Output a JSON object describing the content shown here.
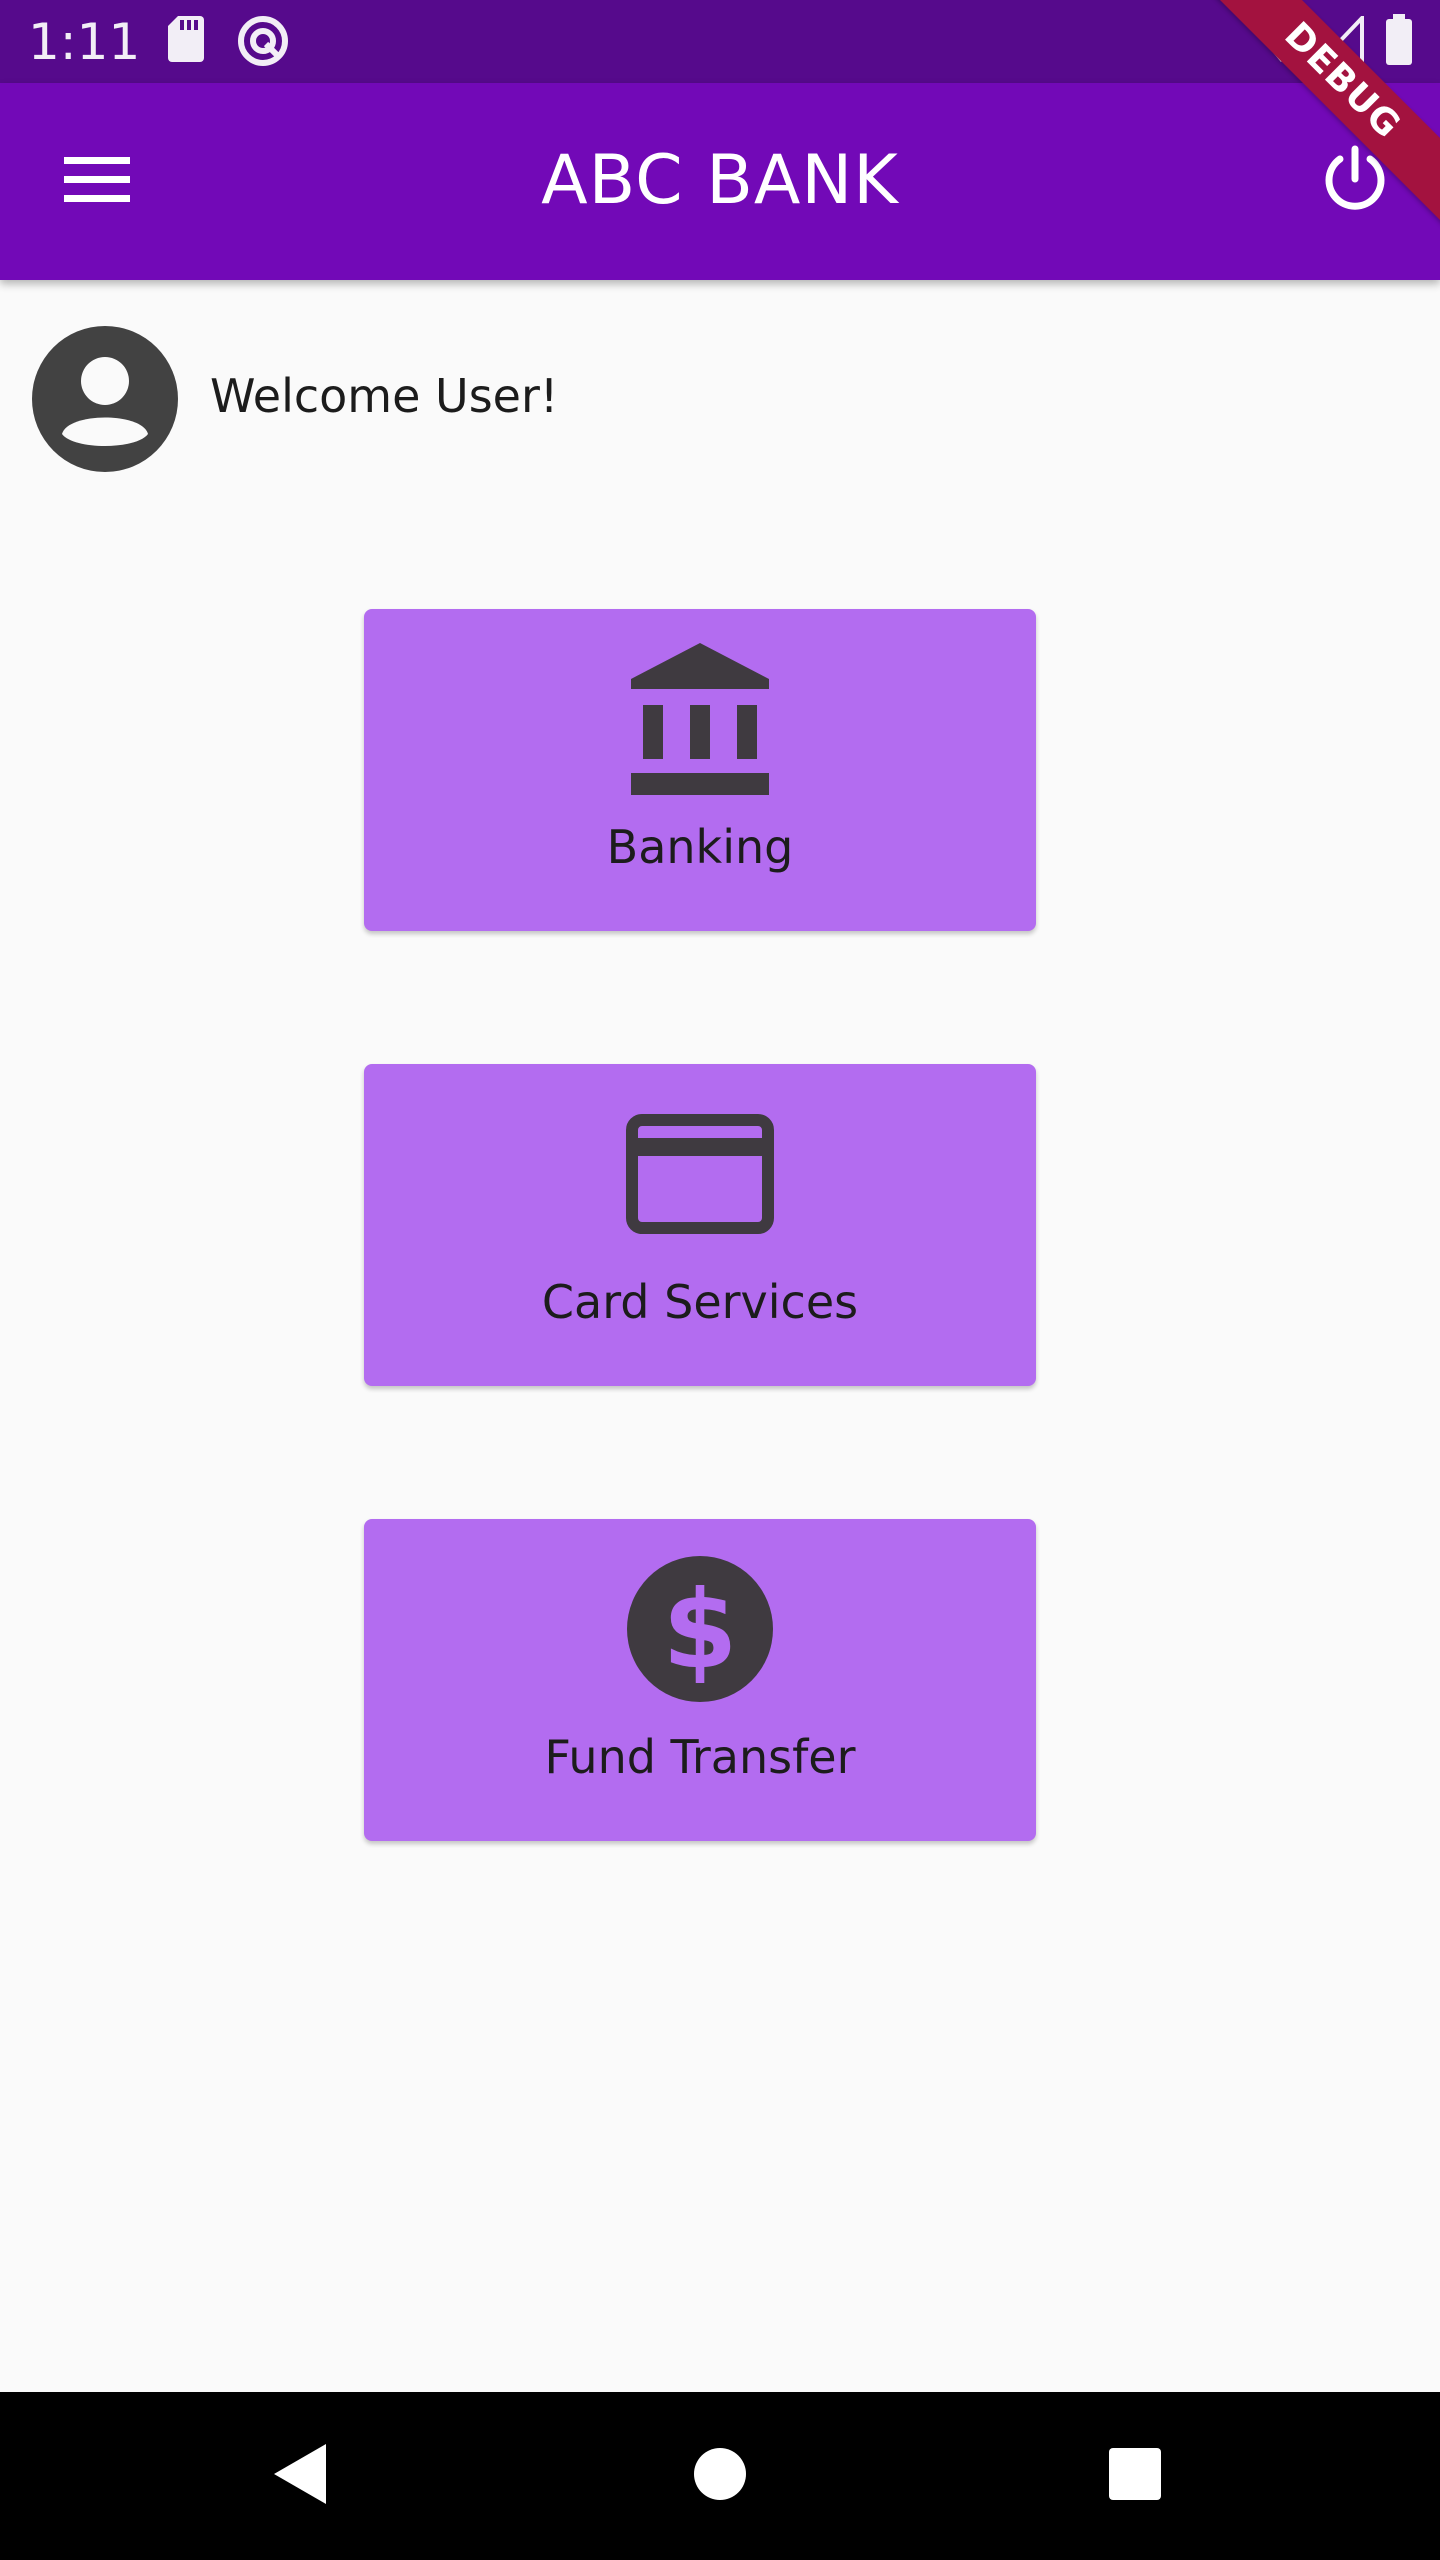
{
  "status_bar": {
    "time": "1:11",
    "icons": [
      "sd-card-icon",
      "sync-icon",
      "wifi-icon",
      "signal-icon",
      "battery-icon"
    ]
  },
  "app_bar": {
    "title": "ABC BANK",
    "menu_icon": "menu-icon",
    "power_icon": "power-icon",
    "debug_label": "DEBUG"
  },
  "welcome": {
    "avatar_icon": "account-circle-icon",
    "text": "Welcome User!"
  },
  "tiles": [
    {
      "label": "Banking",
      "icon": "bank-icon"
    },
    {
      "label": "Card Services",
      "icon": "credit-card-icon"
    },
    {
      "label": "Fund Transfer",
      "icon": "dollar-icon"
    }
  ],
  "colors": {
    "status_bar": "#560a8c",
    "app_bar": "#7209b7",
    "tile": "#b36cf0",
    "icon_dark": "#3f3a40",
    "background": "#fafafa"
  },
  "nav_bar": {
    "buttons": [
      "back-icon",
      "home-icon",
      "recents-icon"
    ]
  }
}
